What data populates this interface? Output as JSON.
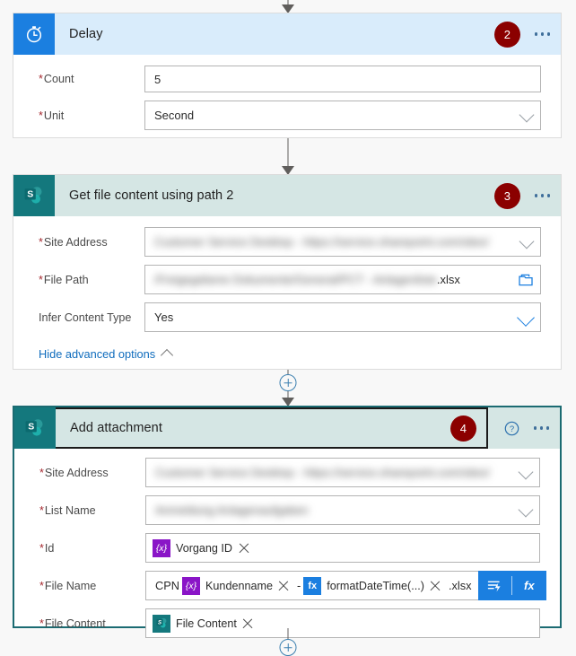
{
  "app": {
    "name": "Power Automate flow designer",
    "background": "#f8f8f8"
  },
  "colors": {
    "badge": "#8b0000",
    "delay_header": "#d9ecfb",
    "delay_icon": "#1b7fe0",
    "sharepoint_header": "#d5e6e4",
    "sharepoint_icon": "#14787d",
    "selected_border": "#1b6b72",
    "accent_blue": "#1b7fe0",
    "link_blue": "#0f6cbd",
    "required_red": "#a4262c",
    "variable_token": "#8a15c7",
    "expression_token": "#1b7fe0"
  },
  "connectors": {
    "top_arrow": "arrow-down-icon",
    "insert_label": "+"
  },
  "cards": [
    {
      "id": "delay",
      "title": "Delay",
      "icon": "stopwatch-icon",
      "badge": "2",
      "selected": false,
      "has_help": false,
      "fields": [
        {
          "label": "Count",
          "required": true,
          "kind": "text",
          "value": "5"
        },
        {
          "label": "Unit",
          "required": true,
          "kind": "dropdown",
          "value": "Second"
        }
      ]
    },
    {
      "id": "get-file-content-using-path-2",
      "title": "Get file content using path 2",
      "icon": "sharepoint-icon",
      "badge": "3",
      "selected": false,
      "has_help": false,
      "fields": [
        {
          "label": "Site Address",
          "required": true,
          "kind": "dropdown",
          "value": "Customer Service Desktop - https://service.sharepoint.com/sites/",
          "redacted": true
        },
        {
          "label": "File Path",
          "required": true,
          "kind": "file",
          "value": "/Freigegebene Dokumente/General/PCT - Anlagenliste",
          "redacted": true,
          "suffix": ".xlsx"
        },
        {
          "label": "Infer Content Type",
          "required": false,
          "kind": "dropdown",
          "value": "Yes"
        }
      ],
      "advanced_link": "Hide advanced options"
    },
    {
      "id": "add-attachment",
      "title": "Add attachment",
      "icon": "sharepoint-icon",
      "badge": "4",
      "selected": true,
      "has_help": true,
      "help_icon": "help-circle-icon",
      "fields": [
        {
          "label": "Site Address",
          "required": true,
          "kind": "dropdown",
          "value": "Customer Service Desktop - https://service.sharepoint.com/sites/",
          "redacted": true
        },
        {
          "label": "List Name",
          "required": true,
          "kind": "dropdown",
          "value": "Anmeldung Anlagenaufgaben",
          "redacted": true
        },
        {
          "label": "Id",
          "required": true,
          "kind": "tokens",
          "tokens": [
            {
              "type": "variable",
              "icon": "{x}",
              "text": "Vorgang ID",
              "removable": true
            }
          ]
        },
        {
          "label": "File Name",
          "required": true,
          "kind": "tokens",
          "has_dynamic_buttons": true,
          "tokens": [
            {
              "type": "text",
              "text": "CPN"
            },
            {
              "type": "variable",
              "icon": "{x}",
              "text": "Kundenname",
              "removable": true
            },
            {
              "type": "text",
              "text": "-"
            },
            {
              "type": "expression",
              "icon": "fx",
              "text": "formatDateTime(...)",
              "removable": true
            },
            {
              "type": "text",
              "text": ".xlsx"
            }
          ]
        },
        {
          "label": "File Content",
          "required": true,
          "kind": "tokens",
          "tokens": [
            {
              "type": "sharepoint",
              "icon": "sharepoint-icon",
              "text": "File Content",
              "removable": true
            }
          ]
        }
      ]
    }
  ],
  "dynamic_buttons": {
    "dynamic_content": "dynamic-content-icon",
    "expression": "fx"
  },
  "menu_label": "..."
}
